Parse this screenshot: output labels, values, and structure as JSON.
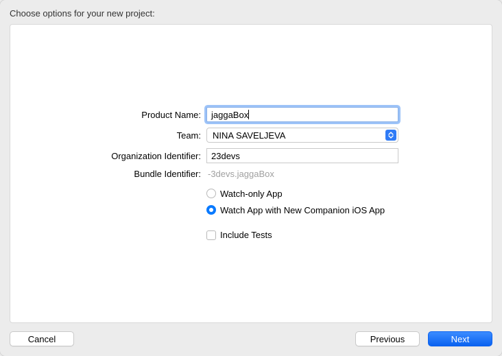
{
  "title": "Choose options for your new project:",
  "form": {
    "productName": {
      "label": "Product Name:",
      "value": "jaggaBox"
    },
    "team": {
      "label": "Team:",
      "value": "NINA SAVELJEVA"
    },
    "orgIdentifier": {
      "label": "Organization Identifier:",
      "value": "23devs"
    },
    "bundleIdentifier": {
      "label": "Bundle Identifier:",
      "value": "-3devs.jaggaBox"
    },
    "appType": {
      "options": [
        {
          "label": "Watch-only App",
          "selected": false
        },
        {
          "label": "Watch App with New Companion iOS App",
          "selected": true
        }
      ]
    },
    "includeTests": {
      "label": "Include Tests",
      "checked": false
    }
  },
  "buttons": {
    "cancel": "Cancel",
    "previous": "Previous",
    "next": "Next"
  }
}
